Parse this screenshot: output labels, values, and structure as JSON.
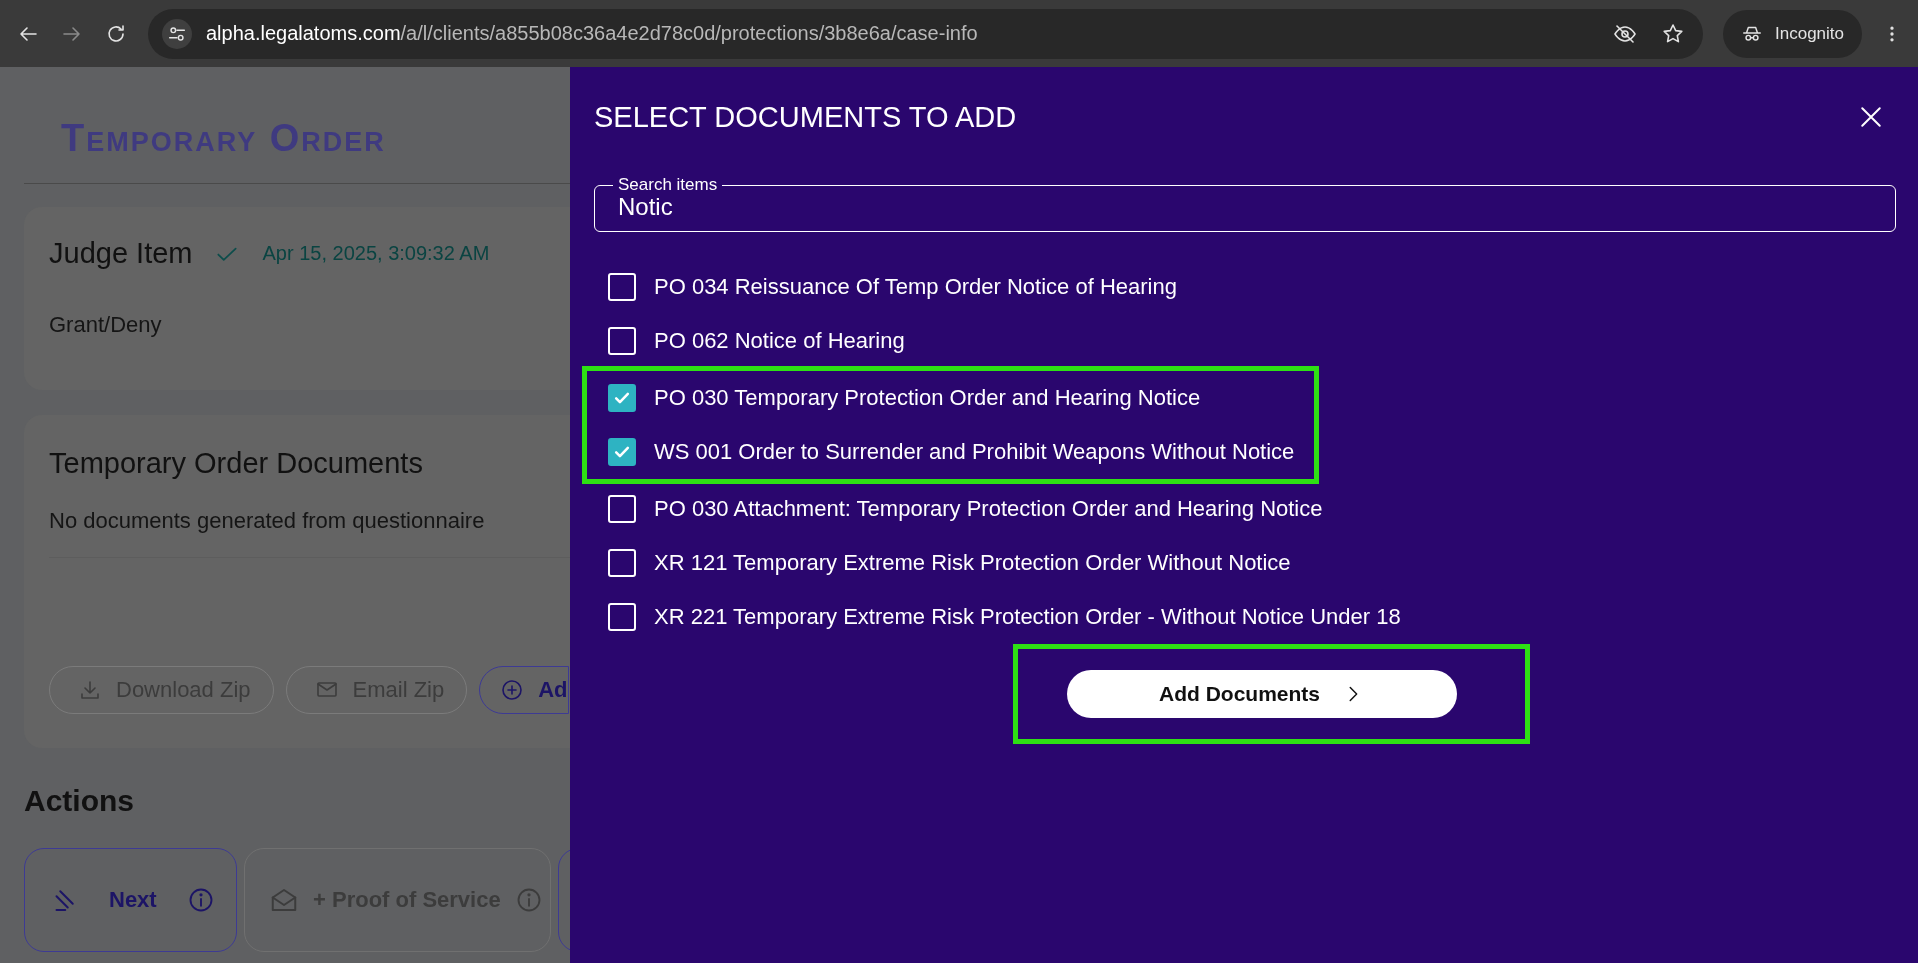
{
  "browser": {
    "url_host": "alpha.legalatoms.com",
    "url_path": "/a/l/clients/a855b08c36a4e2d78c0d/protections/3b8e6a/case-info",
    "profile_label": "Incognito"
  },
  "page": {
    "title": "Temporary Order",
    "judge_card": {
      "title": "Judge Item",
      "done": true,
      "timestamp": "Apr 15, 2025, 3:09:32 AM",
      "text": "Grant/Deny"
    },
    "documents_card": {
      "title": "Temporary Order Documents",
      "message": "No documents generated from questionnaire",
      "buttons": [
        {
          "label": "Download Zip",
          "kind": "download"
        },
        {
          "label": "Email Zip",
          "kind": "email"
        },
        {
          "label": "Ad",
          "kind": "add"
        }
      ]
    },
    "actions": {
      "title": "Actions",
      "items": [
        {
          "label": "Next",
          "kind": "gavel",
          "selected": true
        },
        {
          "label": "+ Proof of Service",
          "kind": "mail",
          "selected": false
        },
        {
          "kind": "blank",
          "selected": true
        }
      ]
    }
  },
  "dialog": {
    "title": "SELECT DOCUMENTS TO ADD",
    "search": {
      "label": "Search items",
      "value": "Notic"
    },
    "items": [
      {
        "label": "PO 034 Reissuance Of Temp Order Notice of Hearing",
        "checked": false,
        "highlighted": false
      },
      {
        "label": "PO 062 Notice of Hearing",
        "checked": false,
        "highlighted": false
      },
      {
        "label": "PO 030 Temporary Protection Order and Hearing Notice",
        "checked": true,
        "highlighted": true
      },
      {
        "label": "WS 001 Order to Surrender and Prohibit Weapons Without Notice",
        "checked": true,
        "highlighted": true
      },
      {
        "label": "PO 030 Attachment: Temporary Protection Order and Hearing Notice",
        "checked": false,
        "highlighted": false
      },
      {
        "label": "XR 121 Temporary Extreme Risk Protection Order Without Notice",
        "checked": false,
        "highlighted": false
      },
      {
        "label": "XR 221 Temporary Extreme Risk Protection Order - Without Notice Under 18",
        "checked": false,
        "highlighted": false
      }
    ],
    "submit": {
      "label": "Add Documents",
      "highlighted": true
    }
  }
}
